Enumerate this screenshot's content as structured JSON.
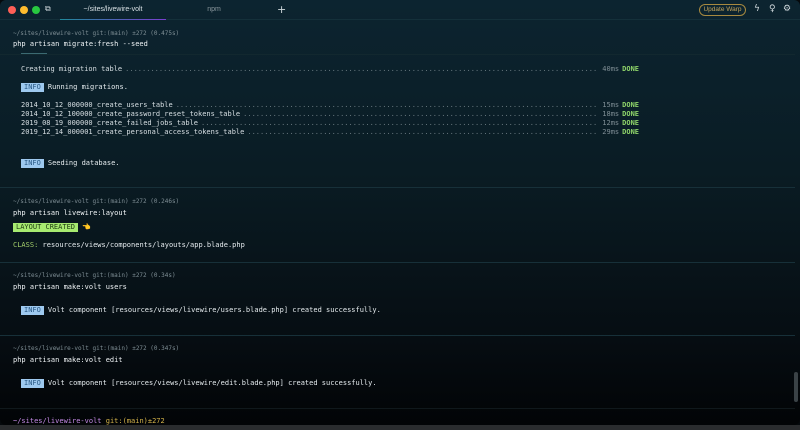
{
  "tabs": [
    {
      "label": "~/sites/livewire-volt",
      "active": true
    },
    {
      "label": "npm",
      "active": false
    }
  ],
  "toolbar": {
    "update_label": "Update Warp",
    "icons": [
      "new-tab-icon",
      "lightning-icon",
      "lightbulb-icon",
      "settings-icon"
    ]
  },
  "blocks": [
    {
      "prompt": "~/sites/livewire-volt git:(main) ±272 (0.475s)",
      "command": "php artisan migrate:fresh --seed",
      "creating": {
        "label": "Creating migration table",
        "time": "40ms",
        "status": "DONE"
      },
      "info1": {
        "badge": "INFO",
        "text": "Running migrations."
      },
      "migrations": [
        {
          "name": "2014_10_12_000000_create_users_table",
          "time": "15ms",
          "status": "DONE"
        },
        {
          "name": "2014_10_12_100000_create_password_reset_tokens_table",
          "time": "18ms",
          "status": "DONE"
        },
        {
          "name": "2019_08_19_000000_create_failed_jobs_table",
          "time": "12ms",
          "status": "DONE"
        },
        {
          "name": "2019_12_14_000001_create_personal_access_tokens_table",
          "time": "29ms",
          "status": "DONE"
        }
      ],
      "info2": {
        "badge": "INFO",
        "text": "Seeding database."
      }
    },
    {
      "prompt": "~/sites/livewire-volt git:(main) ±272 (0.246s)",
      "command": "php artisan livewire:layout",
      "badge": "LAYOUT CREATED",
      "emoji": "👈",
      "class_label": "CLASS:",
      "class_path": "resources/views/components/layouts/app.blade.php"
    },
    {
      "prompt": "~/sites/livewire-volt git:(main) ±272 (0.34s)",
      "command": "php artisan make:volt users",
      "badge": "INFO",
      "text": "Volt component [resources/views/livewire/users.blade.php] created successfully."
    },
    {
      "prompt": "~/sites/livewire-volt git:(main) ±272 (0.347s)",
      "command": "php artisan make:volt edit",
      "badge": "INFO",
      "text": "Volt component [resources/views/livewire/edit.blade.php] created successfully."
    }
  ],
  "current_prompt": {
    "path": "~/sites/livewire-volt",
    "git": "git:(main)±272"
  }
}
